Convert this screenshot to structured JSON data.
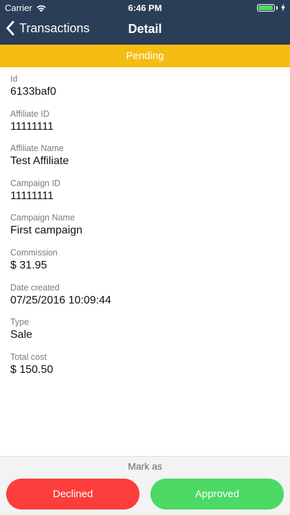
{
  "status_bar": {
    "carrier": "Carrier",
    "time": "6:46 PM",
    "battery_level": 0.95,
    "battery_color": "#4cd964"
  },
  "nav": {
    "back_label": "Transactions",
    "title": "Detail"
  },
  "status": {
    "label": "Pending",
    "color": "#f5bd13"
  },
  "fields": [
    {
      "label": "Id",
      "value": "6133baf0"
    },
    {
      "label": "Affiliate ID",
      "value": "11111111"
    },
    {
      "label": "Affiliate Name",
      "value": "Test Affiliate"
    },
    {
      "label": "Campaign ID",
      "value": "11111111"
    },
    {
      "label": "Campaign Name",
      "value": "First campaign"
    },
    {
      "label": "Commission",
      "value": "$ 31.95"
    },
    {
      "label": "Date created",
      "value": "07/25/2016 10:09:44"
    },
    {
      "label": "Type",
      "value": "Sale"
    },
    {
      "label": "Total cost",
      "value": "$ 150.50"
    }
  ],
  "actions": {
    "mark_as_label": "Mark as",
    "declined_label": "Declined",
    "approved_label": "Approved",
    "declined_color": "#fc3d3c",
    "approved_color": "#4cd964"
  },
  "colors": {
    "nav_background": "#2b3e57"
  }
}
